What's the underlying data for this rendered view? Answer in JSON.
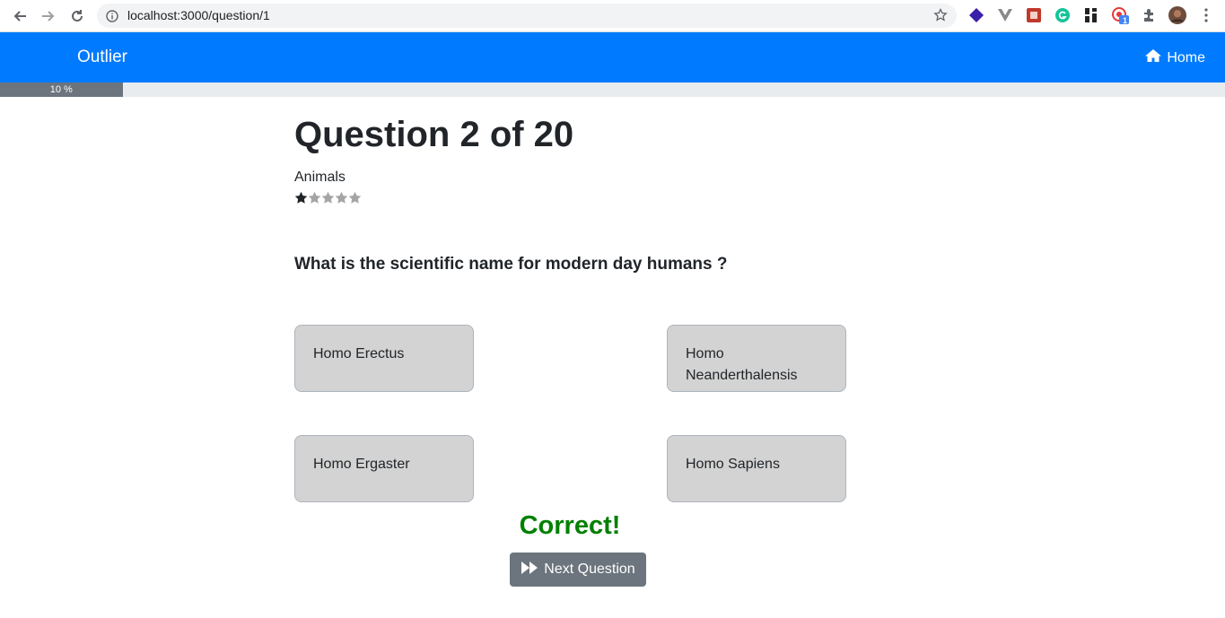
{
  "browser": {
    "url": "localhost:3000/question/1",
    "extension_badge": "1"
  },
  "navbar": {
    "brand": "Outlier",
    "home_label": "Home"
  },
  "progress": {
    "percent": 10,
    "label": "10 %"
  },
  "quiz": {
    "title": "Question 2 of 20",
    "category": "Animals",
    "difficulty": {
      "filled": 1,
      "total": 5
    },
    "question": "What is the scientific name for modern day humans ?",
    "answers": [
      "Homo Erectus",
      "Homo Neanderthalensis",
      "Homo Ergaster",
      "Homo Sapiens"
    ],
    "result": "Correct!",
    "next_label": "Next Question"
  },
  "colors": {
    "navbar": "#007bff",
    "progress_fill": "#6c757d",
    "answer_bg": "#d3d3d3",
    "correct": "#008000"
  }
}
